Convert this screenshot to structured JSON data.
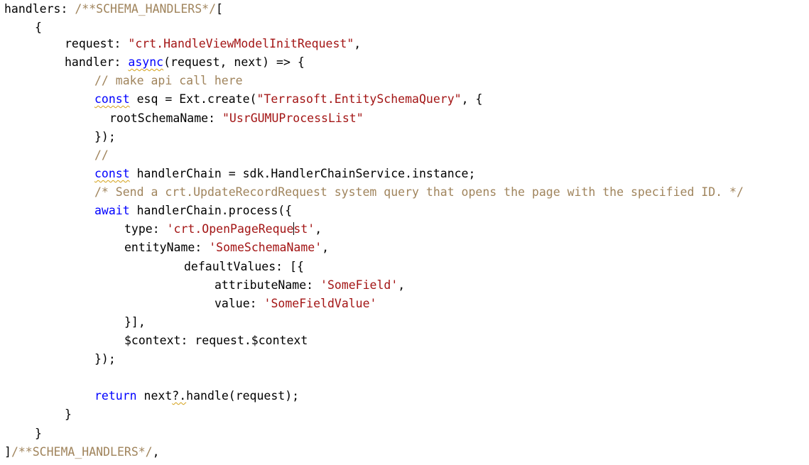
{
  "editor": {
    "colors": {
      "background": "#ffffff",
      "plain": "#000000",
      "keyword": "#0000ff",
      "string": "#a31515",
      "comment": "#a0845c",
      "squiggle": "#d4a017"
    },
    "lines": [
      [
        {
          "t": "handlers: ",
          "k": "plain"
        },
        {
          "t": "/**SCHEMA_HANDLERS*/",
          "k": "comment"
        },
        {
          "t": "[",
          "k": "plain"
        }
      ],
      [
        {
          "t": "{",
          "k": "plain"
        }
      ],
      [
        {
          "t": "request: ",
          "k": "plain"
        },
        {
          "t": "\"crt.HandleViewModelInitRequest\"",
          "k": "string"
        },
        {
          "t": ",",
          "k": "plain"
        }
      ],
      [
        {
          "t": "handler: ",
          "k": "plain"
        },
        {
          "t": "async",
          "k": "keyword",
          "sq": true
        },
        {
          "t": "(request, next) => {",
          "k": "plain"
        }
      ],
      [
        {
          "t": "// make api call here",
          "k": "comment"
        }
      ],
      [
        {
          "t": "const",
          "k": "keyword",
          "sq": true
        },
        {
          "t": " esq = Ext.create(",
          "k": "plain"
        },
        {
          "t": "\"Terrasoft.EntitySchemaQuery\"",
          "k": "string"
        },
        {
          "t": ", {",
          "k": "plain"
        }
      ],
      [
        {
          "t": "rootSchemaName: ",
          "k": "plain"
        },
        {
          "t": "\"UsrGUMUProcessList\"",
          "k": "string"
        }
      ],
      [
        {
          "t": "});",
          "k": "plain"
        }
      ],
      [
        {
          "t": "//",
          "k": "comment"
        }
      ],
      [
        {
          "t": "const",
          "k": "keyword",
          "sq": true
        },
        {
          "t": " handlerChain = sdk.HandlerChainService.instance;",
          "k": "plain"
        }
      ],
      [
        {
          "t": "/* Send a crt.UpdateRecordRequest system query that opens the page with the specified ID. */",
          "k": "comment"
        }
      ],
      [
        {
          "t": "await",
          "k": "keyword"
        },
        {
          "t": " handlerChain.process({",
          "k": "plain"
        }
      ],
      [
        {
          "t": "type: ",
          "k": "plain"
        },
        {
          "t": "'crt.OpenPageReque",
          "k": "string"
        },
        {
          "caret": true
        },
        {
          "t": "st'",
          "k": "string"
        },
        {
          "t": ",",
          "k": "plain"
        }
      ],
      [
        {
          "t": "entityName: ",
          "k": "plain"
        },
        {
          "t": "'SomeSchemaName'",
          "k": "string"
        },
        {
          "t": ",",
          "k": "plain"
        }
      ],
      [
        {
          "t": "defaultValues: [{",
          "k": "plain"
        }
      ],
      [
        {
          "t": "attributeName: ",
          "k": "plain"
        },
        {
          "t": "'SomeField'",
          "k": "string"
        },
        {
          "t": ",",
          "k": "plain"
        }
      ],
      [
        {
          "t": "value: ",
          "k": "plain"
        },
        {
          "t": "'SomeFieldValue'",
          "k": "string"
        }
      ],
      [
        {
          "t": "}],",
          "k": "plain"
        }
      ],
      [
        {
          "t": "$context: request.$context",
          "k": "plain"
        }
      ],
      [
        {
          "t": "});",
          "k": "plain"
        }
      ],
      [],
      [
        {
          "t": "return",
          "k": "keyword"
        },
        {
          "t": " next",
          "k": "plain"
        },
        {
          "t": "?.",
          "k": "plain",
          "sq": true
        },
        {
          "t": "handle(request);",
          "k": "plain"
        }
      ],
      [
        {
          "t": "}",
          "k": "plain"
        }
      ],
      [
        {
          "t": "}",
          "k": "plain"
        }
      ],
      [
        {
          "t": "]",
          "k": "plain"
        },
        {
          "t": "/**SCHEMA_HANDLERS*/",
          "k": "comment"
        },
        {
          "t": ",",
          "k": "plain"
        }
      ]
    ]
  }
}
